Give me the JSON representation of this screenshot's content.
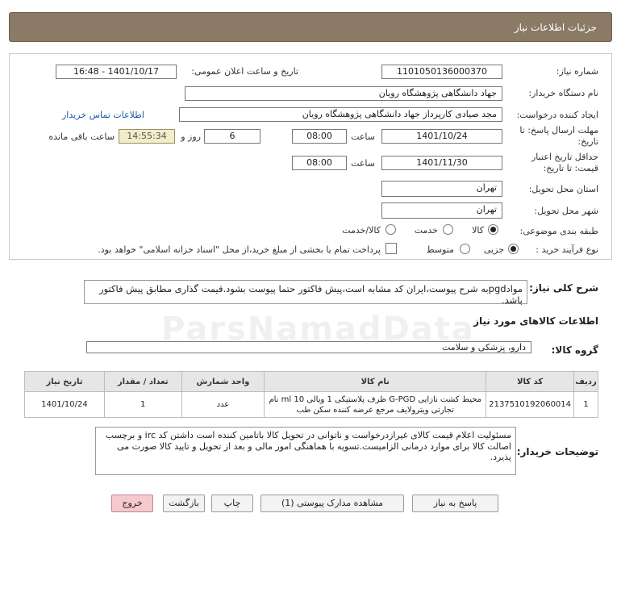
{
  "header": {
    "title": "جزئیات اطلاعات نیاز"
  },
  "form": {
    "need_number_label": "شماره نیاز:",
    "need_number": "1101050136000370",
    "announce_label": "تاریخ و ساعت اعلان عمومی:",
    "announce_value": "1401/10/17 - 16:48",
    "buyer_org_label": "نام دستگاه خریدار:",
    "buyer_org": "جهاد دانشگاهی پژوهشگاه رویان",
    "requester_label": "ایجاد کننده درخواست:",
    "requester": "مجد صیادی کارپرداز جهاد دانشگاهی پژوهشگاه رویان",
    "contact_link": "اطلاعات تماس خریدار",
    "deadline_label_1": "مهلت ارسال پاسخ: تا",
    "deadline_label_2": "تاریخ:",
    "deadline_date": "1401/10/24",
    "time_label": "ساعت",
    "deadline_time": "08:00",
    "days_value": "6",
    "days_label": "روز و",
    "remaining_time": "14:55:34",
    "remaining_label": "ساعت باقی مانده",
    "validity_label_1": "حداقل تاریخ اعتبار",
    "validity_label_2": "قیمت: تا تاریخ:",
    "validity_date": "1401/11/30",
    "validity_time_label": "ساعت",
    "validity_time": "08:00",
    "province_label": "استان محل تحویل:",
    "province": "تهران",
    "city_label": "شهر محل تحویل:",
    "city": "تهران",
    "category_label": "طبقه بندی موضوعی:",
    "category_options": [
      "کالا",
      "خدمت",
      "کالا/خدمت"
    ],
    "process_label": "نوع فرآیند خرید :",
    "process_options": [
      "جزیی",
      "متوسط"
    ],
    "payment_note": "پرداخت تمام یا بخشی از مبلغ خرید،از محل \"اسناد خزانه اسلامی\" خواهد بود."
  },
  "summary": {
    "label": "شرح کلی نیاز:",
    "text": "موادpgdبه شرح پیوست،ایران کد مشابه است،پیش فاکتور حتما پیوست بشود.قیمت گذاری مطابق پیش فاکتور باشد."
  },
  "goods": {
    "section_title": "اطلاعات کالاهای مورد نیاز",
    "group_label": "گروه کالا:",
    "group_value": "دارو، پزشکی و سلامت",
    "columns": [
      "ردیف",
      "کد کالا",
      "نام کالا",
      "واحد شمارش",
      "تعداد / مقدار",
      "تاریخ نیاز"
    ],
    "rows": [
      {
        "row": "1",
        "code": "2137510192060014",
        "name": "محیط کشت نازایی G-PGD ظرف پلاستیکی 1 ویالی 10 ml نام تجارتی ویترولایف مرجع عرضه کننده سکن طب",
        "unit": "عدد",
        "qty": "1",
        "date": "1401/10/24"
      }
    ]
  },
  "buyer_notes": {
    "label": "توضیحات خریدار:",
    "text": "مسئولیت اعلام قیمت کالای غیرازدرخواست و ناتوانی در تحویل کالا باتامین کننده است داشتن کد irc و برچسب اصالت کالا  برای موارد درمانی الزامیست.تسویه با هماهنگی امور مالی و بعد از تحویل و تایید کالا صورت می پذیرد."
  },
  "buttons": {
    "reply": "پاسخ به نیاز",
    "view_docs": "مشاهده مدارک پیوستی (1)",
    "print": "چاپ",
    "back": "بازگشت",
    "exit": "خروج"
  },
  "colors": {
    "titlebar": "#8a7a66",
    "highlight": "#f4ecc8",
    "link": "#1e5aa8",
    "exit_button": "#f6c9cf"
  }
}
